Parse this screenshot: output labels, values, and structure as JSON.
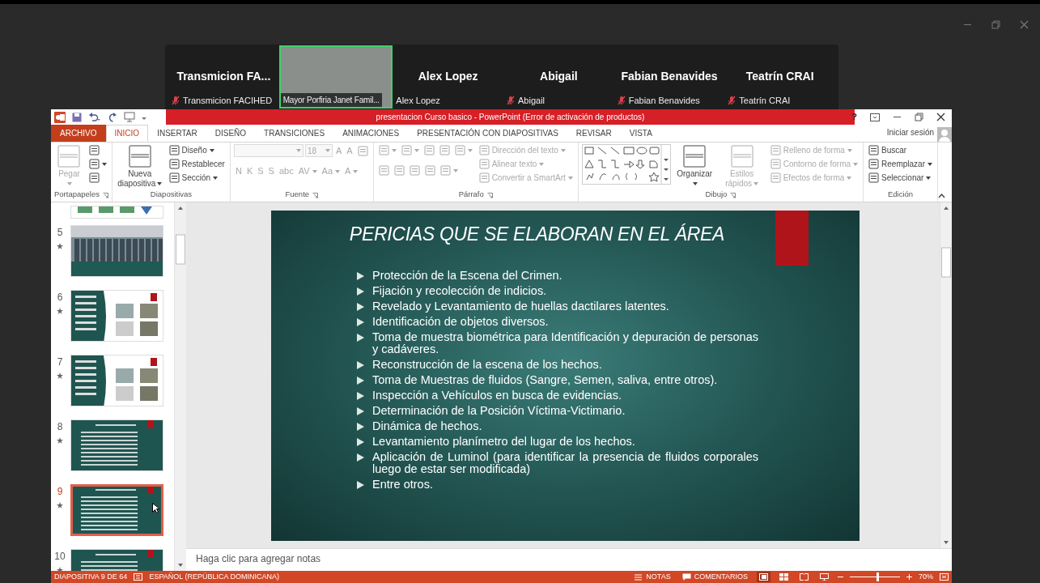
{
  "meeting": {
    "participants": [
      {
        "name": "Transmicion  FA...",
        "label": "Transmicion FACIHED",
        "muted": true,
        "video": false
      },
      {
        "label": "Mayor Porfiria Janet Famil...",
        "muted": false,
        "video": true,
        "speaking": true
      },
      {
        "name": "Alex Lopez",
        "label": "Alex Lopez",
        "muted": false,
        "video": false
      },
      {
        "name": "Abigail",
        "label": "Abigail",
        "muted": true,
        "video": false
      },
      {
        "name": "Fabian Benavides",
        "label": "Fabian Benavides",
        "muted": true,
        "video": false
      },
      {
        "name": "Teatrín CRAI",
        "label": "Teatrín CRAI",
        "muted": true,
        "video": false
      }
    ]
  },
  "powerpoint": {
    "title": "presentacion  Curso basico -  PowerPoint (Error de activación de productos)",
    "help": "?",
    "sign_in": "Iniciar sesión",
    "tabs": [
      {
        "label": "ARCHIVO",
        "kind": "file",
        "selected": false
      },
      {
        "label": "INICIO",
        "kind": "tab",
        "selected": true
      },
      {
        "label": "INSERTAR",
        "kind": "tab",
        "selected": false
      },
      {
        "label": "DISEÑO",
        "kind": "tab",
        "selected": false
      },
      {
        "label": "TRANSICIONES",
        "kind": "tab",
        "selected": false
      },
      {
        "label": "ANIMACIONES",
        "kind": "tab",
        "selected": false
      },
      {
        "label": "PRESENTACIÓN CON DIAPOSITIVAS",
        "kind": "tab",
        "selected": false
      },
      {
        "label": "REVISAR",
        "kind": "tab",
        "selected": false
      },
      {
        "label": "VISTA",
        "kind": "tab",
        "selected": false
      }
    ],
    "ribbon": {
      "groups": [
        {
          "label": "Portapapeles",
          "launcher": true,
          "columns": [
            [
              [
                {
                  "kind": "large",
                  "label": "Pegar",
                  "disabled": true,
                  "dropdown": true
                }
              ]
            ],
            [
              [
                {
                  "kind": "icon",
                  "disabled": false,
                  "dropdown": false
                }
              ],
              [
                {
                  "kind": "icon",
                  "disabled": false,
                  "dropdown": true
                }
              ],
              [
                {
                  "kind": "icon",
                  "disabled": false,
                  "dropdown": false
                }
              ]
            ]
          ]
        },
        {
          "label": "Diapositivas",
          "launcher": false,
          "columns": [
            [
              [
                {
                  "kind": "large",
                  "label": "Nueva diapositiva",
                  "disabled": false,
                  "dropdown": true
                }
              ]
            ],
            [
              [
                {
                  "kind": "small",
                  "label": "Diseño",
                  "disabled": false,
                  "dropdown": true
                }
              ],
              [
                {
                  "kind": "small",
                  "label": "Restablecer",
                  "disabled": false,
                  "dropdown": false
                }
              ],
              [
                {
                  "kind": "small",
                  "label": "Sección",
                  "disabled": false,
                  "dropdown": true
                }
              ]
            ]
          ]
        },
        {
          "label": "Fuente",
          "launcher": true,
          "columns": [
            [
              [
                {
                  "kind": "field",
                  "disabled": true,
                  "dropdown": true
                },
                {
                  "kind": "field",
                  "value": "18",
                  "disabled": true,
                  "dropdown": true
                },
                {
                  "kind": "glyph",
                  "label": "A",
                  "disabled": true,
                  "dropdown": false
                },
                {
                  "kind": "glyph",
                  "label": "A",
                  "disabled": true,
                  "dropdown": false
                },
                {
                  "kind": "icon",
                  "disabled": true,
                  "dropdown": false
                }
              ],
              [
                {
                  "kind": "glyph",
                  "label": "N",
                  "disabled": true,
                  "dropdown": false
                },
                {
                  "kind": "glyph",
                  "label": "K",
                  "disabled": true,
                  "dropdown": false
                },
                {
                  "kind": "glyph",
                  "label": "S",
                  "disabled": true,
                  "dropdown": false
                },
                {
                  "kind": "glyph",
                  "label": "S",
                  "disabled": true,
                  "dropdown": false
                },
                {
                  "kind": "glyph",
                  "label": "abc",
                  "disabled": true,
                  "dropdown": false
                },
                {
                  "kind": "glyph",
                  "label": "AV",
                  "disabled": true,
                  "dropdown": true
                },
                {
                  "kind": "glyph",
                  "label": "Aa",
                  "disabled": true,
                  "dropdown": true
                },
                {
                  "kind": "glyph",
                  "label": "A",
                  "disabled": true,
                  "dropdown": true
                }
              ]
            ]
          ]
        },
        {
          "label": "Párrafo",
          "launcher": true,
          "columns": [
            [
              [
                {
                  "kind": "icon",
                  "disabled": true,
                  "dropdown": true
                },
                {
                  "kind": "icon",
                  "disabled": true,
                  "dropdown": true
                },
                {
                  "kind": "icon",
                  "disabled": true,
                  "dropdown": false
                },
                {
                  "kind": "icon",
                  "disabled": true,
                  "dropdown": false
                },
                {
                  "kind": "icon",
                  "disabled": true,
                  "dropdown": true
                }
              ],
              [
                {
                  "kind": "icon",
                  "disabled": true,
                  "dropdown": false
                },
                {
                  "kind": "icon",
                  "disabled": true,
                  "dropdown": false
                },
                {
                  "kind": "icon",
                  "disabled": true,
                  "dropdown": false
                },
                {
                  "kind": "icon",
                  "disabled": true,
                  "dropdown": false
                },
                {
                  "kind": "icon",
                  "disabled": true,
                  "dropdown": true
                }
              ]
            ],
            [
              [
                {
                  "kind": "small",
                  "label": "Dirección del texto",
                  "disabled": true,
                  "dropdown": true
                }
              ],
              [
                {
                  "kind": "small",
                  "label": "Alinear texto",
                  "disabled": true,
                  "dropdown": true
                }
              ],
              [
                {
                  "kind": "small",
                  "label": "Convertir a SmartArt",
                  "disabled": true,
                  "dropdown": true
                }
              ]
            ]
          ]
        },
        {
          "label": "Dibujo",
          "launcher": true,
          "columns": [
            [
              [
                {
                  "kind": "gallery",
                  "disabled": false,
                  "dropdown": false
                }
              ]
            ],
            [
              [
                {
                  "kind": "large",
                  "label": "Organizar",
                  "disabled": false,
                  "dropdown": true
                }
              ]
            ],
            [
              [
                {
                  "kind": "large",
                  "label": "Estilos rápidos",
                  "disabled": true,
                  "dropdown": true
                }
              ]
            ],
            [
              [
                {
                  "kind": "small",
                  "label": "Relleno de forma",
                  "disabled": true,
                  "dropdown": true
                }
              ],
              [
                {
                  "kind": "small",
                  "label": "Contorno de forma",
                  "disabled": true,
                  "dropdown": true
                }
              ],
              [
                {
                  "kind": "small",
                  "label": "Efectos de forma",
                  "disabled": true,
                  "dropdown": true
                }
              ]
            ]
          ]
        },
        {
          "label": "Edición",
          "launcher": false,
          "columns": [
            [
              [
                {
                  "kind": "small",
                  "label": "Buscar",
                  "disabled": false,
                  "dropdown": false
                }
              ],
              [
                {
                  "kind": "small",
                  "label": "Reemplazar",
                  "disabled": false,
                  "dropdown": true
                }
              ],
              [
                {
                  "kind": "small",
                  "label": "Seleccionar",
                  "disabled": false,
                  "dropdown": true
                }
              ]
            ]
          ]
        }
      ]
    },
    "thumbnails": [
      {
        "kind": "partial",
        "selected": false
      },
      {
        "number": "5",
        "kind": "photo",
        "selected": false
      },
      {
        "number": "6",
        "kind": "split",
        "selected": false
      },
      {
        "number": "7",
        "kind": "split",
        "selected": false
      },
      {
        "number": "8",
        "kind": "dark",
        "selected": false
      },
      {
        "number": "9",
        "kind": "dark",
        "selected": true
      },
      {
        "number": "10",
        "kind": "dark",
        "selected": false
      }
    ],
    "slide": {
      "title": "PERICIAS QUE SE ELABORAN EN EL ÁREA",
      "bullets": [
        "Protección de la Escena del Crimen.",
        "Fijación y recolección de indicios.",
        "Revelado y Levantamiento de huellas dactilares latentes.",
        "Identificación de objetos diversos.",
        "Toma de muestra biométrica para Identificación y depuración de personas y cadáveres.",
        "Reconstrucción de la escena de los hechos.",
        "Toma de Muestras de fluidos (Sangre, Semen, saliva, entre otros).",
        "Inspección a Vehículos en busca de evidencias.",
        "Determinación de la Posición Víctima-Victimario.",
        "Dinámica de hechos.",
        "Levantamiento planímetro del lugar de los hechos.",
        "Aplicación de Luminol (para identificar la presencia de fluidos corporales luego de estar ser modificada)",
        "Entre otros."
      ]
    },
    "notes_placeholder": "Haga clic para agregar notas",
    "status_bar": {
      "slide_info": "DIAPOSITIVA 9 DE 64",
      "language": "ESPAÑOL (REPÚBLICA DOMINICANA)",
      "notes": "NOTAS",
      "comments": "COMENTARIOS",
      "views": [
        {
          "selected": true
        },
        {
          "selected": false
        },
        {
          "selected": false
        },
        {
          "selected": false
        }
      ],
      "zoom_slider": {
        "level": 0.55
      },
      "zoom": "70%"
    }
  }
}
